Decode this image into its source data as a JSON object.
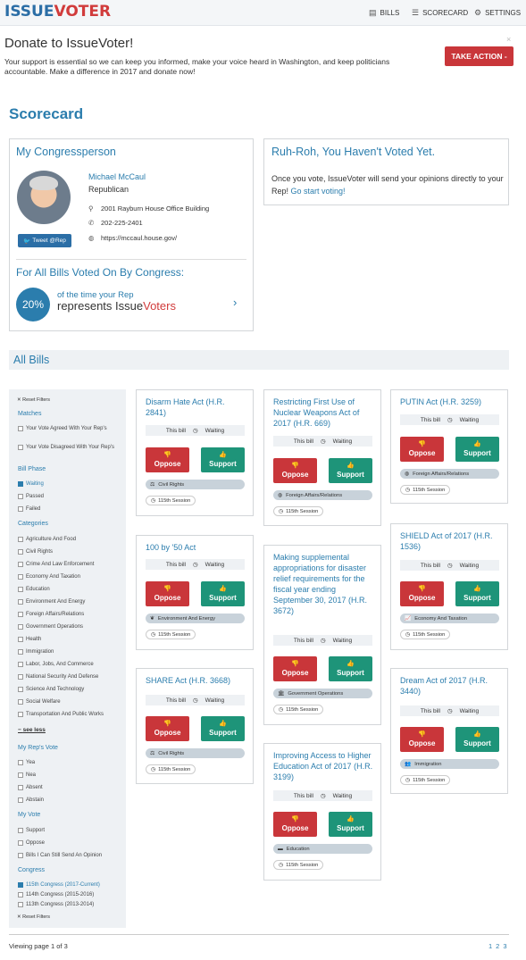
{
  "nav": {
    "logo_a": "ISSUE",
    "logo_b": "VOTER",
    "bills": "BILLS",
    "scorecard": "SCORECARD",
    "settings": "SETTINGS"
  },
  "donate": {
    "title": "Donate to IssueVoter!",
    "text": "Your support is essential so we can keep you informed, make your voice heard in Washington, and keep politicians accountable. Make a difference in 2017 and donate now!",
    "button": "TAKE ACTION -",
    "close": "×"
  },
  "scorecard_title": "Scorecard",
  "congressperson": {
    "heading": "My Congressperson",
    "name": "Michael McCaul",
    "party": "Republican",
    "address": "2001 Rayburn House Office Building",
    "phone": "202-225-2401",
    "website": "https://mccaul.house.gov/",
    "tweet": "Tweet @Rep",
    "for_all": "For All Bills Voted On By Congress:",
    "percent": "20%",
    "pct_line1": "of the time your Rep",
    "pct_line2a": "represents Issue",
    "pct_line2b": "Voters"
  },
  "not_voted": {
    "heading": "Ruh-Roh, You Haven't Voted Yet.",
    "text": "Once you vote, IssueVoter will send your opinions directly to your Rep!",
    "link": "Go start voting!"
  },
  "all_bills_title": "All Bills",
  "sidebar": {
    "reset": "Reset Filters",
    "matches": "Matches",
    "match_opts": [
      "Your Vote Agreed With Your Rep's",
      "Your Vote Disagreed With Your Rep's"
    ],
    "phase": "Bill Phase",
    "phase_opts": [
      "Waiting",
      "Passed",
      "Failed"
    ],
    "categories": "Categories",
    "cat_opts": [
      "Agriculture And Food",
      "Civil Rights",
      "Crime And Law Enforcement",
      "Economy And Taxation",
      "Education",
      "Environment And Energy",
      "Foreign Affairs/Relations",
      "Government Operations",
      "Health",
      "Immigration",
      "Labor, Jobs, And Commerce",
      "National Security And Defense",
      "Science And Technology",
      "Social Welfare",
      "Transportation And Public Works"
    ],
    "see_less": "see less",
    "reps_vote": "My Rep's Vote",
    "rep_opts": [
      "Yea",
      "Nea",
      "Absent",
      "Abstain"
    ],
    "my_vote": "My Vote",
    "my_opts": [
      "Support",
      "Oppose",
      "Bills I Can Still Send An Opinion"
    ],
    "congress": "Congress",
    "cong_opts": [
      "115th Congress (2017-Current)",
      "114th Congress (2015-2016)",
      "113th Congress (2013-2014)"
    ]
  },
  "bill_common": {
    "this_bill": "This bill",
    "waiting": "Waiting",
    "oppose": "Oppose",
    "support": "Support",
    "session": "115th Session"
  },
  "bills": [
    {
      "title": "Disarm Hate Act (H.R. 2841)",
      "category": "Civil Rights"
    },
    {
      "title": "100 by '50 Act",
      "category": "Environment And Energy"
    },
    {
      "title": "SHARE Act (H.R. 3668)",
      "category": "Civil Rights"
    },
    {
      "title": "Restricting First Use of Nuclear Weapons Act of 2017 (H.R. 669)",
      "category": "Foreign Affairs/Relations"
    },
    {
      "title": "Making supplemental appropriations for disaster relief requirements for the fiscal year ending September 30, 2017 (H.R. 3672)",
      "category": "Government Operations"
    },
    {
      "title": "Improving Access to Higher Education Act of 2017 (H.R. 3199)",
      "category": "Education"
    },
    {
      "title": "PUTIN Act (H.R. 3259)",
      "category": "Foreign Affairs/Relations"
    },
    {
      "title": "SHIELD Act of 2017 (H.R. 1536)",
      "category": "Economy And Taxation"
    },
    {
      "title": "Dream Act of 2017 (H.R. 3440)",
      "category": "Immigration"
    }
  ],
  "footer": {
    "viewing": "Viewing page 1 of 3",
    "pages": [
      "1",
      "2",
      "3"
    ]
  }
}
